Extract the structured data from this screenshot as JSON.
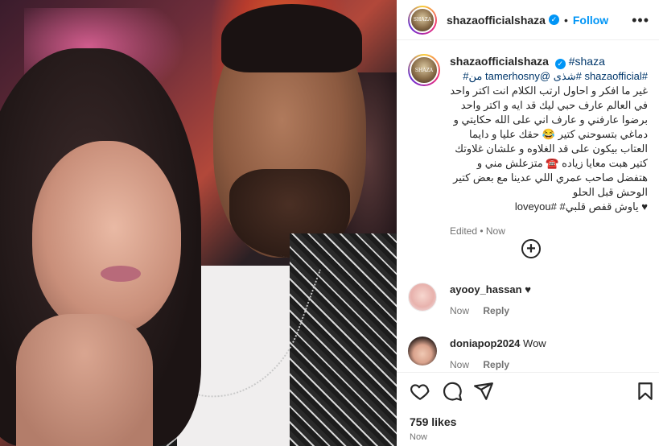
{
  "post": {
    "username": "shazaofficialshaza",
    "verified_mark": "✓",
    "separator": "•",
    "follow_label": "Follow",
    "more_label": "•••",
    "avatar_text": "SHAZA",
    "photo_description": "selfie-photo"
  },
  "caption": {
    "username": "shazaofficialshaza",
    "hashtags_line": "#shaza",
    "text_line1": "#shazaofficial #شذى @tamerhosny من#",
    "text_body": "غير ما افكر و احاول ارتب الكلام انت اكتر واحد في العالم عارف حبي ليك قد ايه و اكتر واحد برضوا عارفني و عارف اني على الله حكايتي و دماغي بتسوحني كتير 😂 حقك عليا و دايما العتاب بيكون على قد الغلاوه و علشان غلاوتك كتير هبت معايا زياده ☎️ متزعلش مني و هتفضل صاحب عمري اللي عدينا مع بعض كتير الوحش قبل الحلو",
    "text_last": "♥ ياوش قفص قلبي# #loveyou",
    "edited": "Edited • Now"
  },
  "add_comment_icon": "+",
  "comments": [
    {
      "username": "ayooy_hassan",
      "text": "♥",
      "time": "Now",
      "reply": "Reply"
    },
    {
      "username": "doniapop2024",
      "text": "Wow",
      "time": "Now",
      "reply": "Reply"
    }
  ],
  "actions": {
    "likes": "759 likes",
    "time": "Now"
  },
  "colors": {
    "link": "#0095f6",
    "hashtag": "#00376b",
    "muted": "#737373"
  }
}
